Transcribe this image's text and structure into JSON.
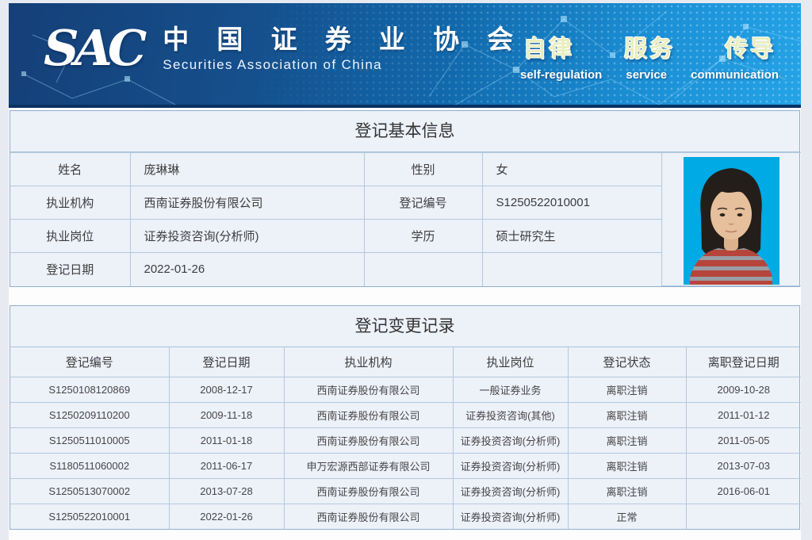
{
  "header": {
    "logo": "SAC",
    "org_name_cn": "中 国 证 券 业 协 会",
    "org_name_en": "Securities Association of China",
    "slogans": [
      {
        "cn": "自律",
        "en": "self-regulation"
      },
      {
        "cn": "服务",
        "en": "service"
      },
      {
        "cn": "传导",
        "en": "communication"
      }
    ]
  },
  "basic_info": {
    "title": "登记基本信息",
    "fields": [
      {
        "label": "姓名",
        "value": "庞琳琳"
      },
      {
        "label": "性别",
        "value": "女"
      },
      {
        "label": "执业机构",
        "value": "西南证券股份有限公司"
      },
      {
        "label": "登记编号",
        "value": "S1250522010001"
      },
      {
        "label": "执业岗位",
        "value": "证券投资咨询(分析师)"
      },
      {
        "label": "学历",
        "value": "硕士研究生"
      },
      {
        "label": "登记日期",
        "value": "2022-01-26"
      }
    ],
    "photo": "id-photo-portrait"
  },
  "change_records": {
    "title": "登记变更记录",
    "columns": [
      "登记编号",
      "登记日期",
      "执业机构",
      "执业岗位",
      "登记状态",
      "离职登记日期"
    ],
    "rows": [
      [
        "S1250108120869",
        "2008-12-17",
        "西南证券股份有限公司",
        "一般证券业务",
        "离职注销",
        "2009-10-28"
      ],
      [
        "S1250209110200",
        "2009-11-18",
        "西南证券股份有限公司",
        "证券投资咨询(其他)",
        "离职注销",
        "2011-01-12"
      ],
      [
        "S1250511010005",
        "2011-01-18",
        "西南证券股份有限公司",
        "证券投资咨询(分析师)",
        "离职注销",
        "2011-05-05"
      ],
      [
        "S1180511060002",
        "2011-06-17",
        "申万宏源西部证券有限公司",
        "证券投资咨询(分析师)",
        "离职注销",
        "2013-07-03"
      ],
      [
        "S1250513070002",
        "2013-07-28",
        "西南证券股份有限公司",
        "证券投资咨询(分析师)",
        "离职注销",
        "2016-06-01"
      ],
      [
        "S1250522010001",
        "2022-01-26",
        "西南证券股份有限公司",
        "证券投资咨询(分析师)",
        "正常",
        ""
      ]
    ]
  },
  "colors": {
    "header_blue_dark": "#153f77",
    "header_blue_light": "#25a3e7",
    "header_bottom_strip": "#0a3263",
    "section_bg": "#edf1f8",
    "section_border": "#8fafcd",
    "cell_border": "#b3c9de",
    "slogan_cn": "#e9eec0",
    "photo_bg": "#00aae4"
  }
}
